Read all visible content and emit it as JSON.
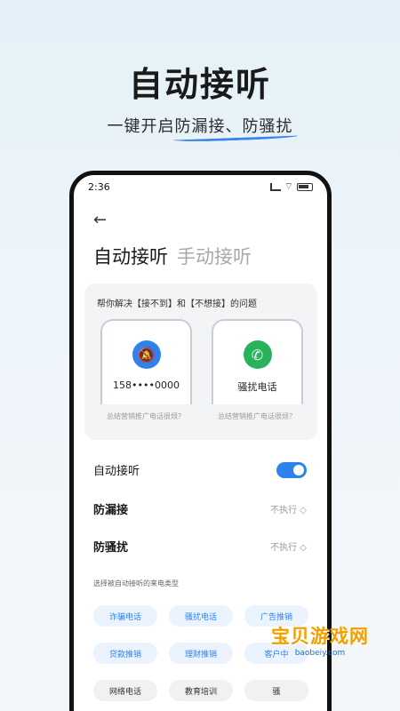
{
  "hero": {
    "title": "自动接听",
    "subtitle": "一键开启防漏接、防骚扰"
  },
  "status_bar": {
    "time": "2:36"
  },
  "page": {
    "tab_active": "自动接听",
    "tab_inactive": "手动接听"
  },
  "help_card": {
    "title": "帮你解决【接不到】和【不想接】的问题",
    "left_card_label": "158••••0000",
    "right_card_label": "骚扰电话",
    "left_caption": "总结营销推广电话很烦？",
    "right_caption": "总结营销推广电话很烦？",
    "left_icon": "mute-bell-icon",
    "right_icon": "phone-icon"
  },
  "settings": {
    "auto_answer_label": "自动接听",
    "auto_answer_on": true,
    "missed_label": "防漏接",
    "missed_value": "不执行 ◇",
    "harass_label": "防骚扰",
    "harass_value": "不执行 ◇"
  },
  "call_types": {
    "section_label": "选择被自动接听的来电类型",
    "chips": [
      "诈骗电话",
      "骚扰电话",
      "广告推销",
      "贷款推销",
      "理财推销",
      "客户中",
      "网络电话",
      "教育培训",
      "骚"
    ]
  },
  "watermark": {
    "text": "宝贝游戏网",
    "url": "baobeiy.com"
  },
  "colors": {
    "accent": "#2d83ee",
    "green": "#28b35a"
  }
}
